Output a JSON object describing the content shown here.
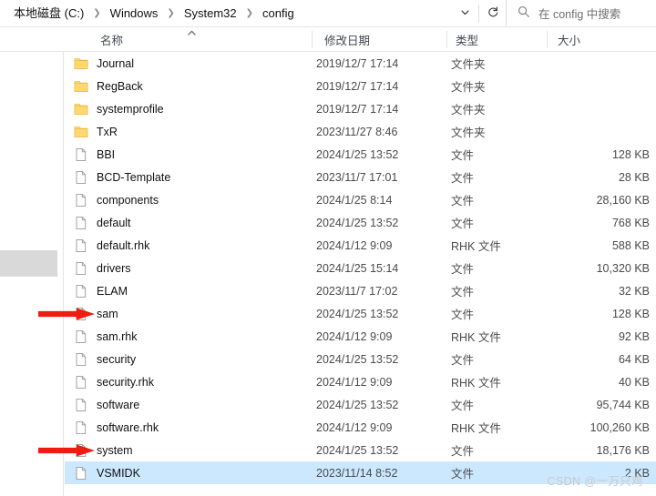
{
  "window": {
    "title": "config"
  },
  "addressbar": {
    "breadcrumbs": [
      {
        "label": "本地磁盘 (C:)"
      },
      {
        "label": "Windows"
      },
      {
        "label": "System32"
      },
      {
        "label": "config"
      }
    ],
    "separator": "❯",
    "dropdown_icon": "chevron-down-icon",
    "refresh_icon": "refresh-icon",
    "search": {
      "icon": "search-icon",
      "placeholder": "在 config 中搜索",
      "value": ""
    }
  },
  "columns": {
    "name": "名称",
    "date_modified": "修改日期",
    "type": "类型",
    "size": "大小",
    "sort": {
      "column": "名称",
      "direction": "ascending",
      "icon": "sort-ascending-caret"
    }
  },
  "files": [
    {
      "name": "Journal",
      "icon": "folder-icon",
      "date": "2019/12/7 17:14",
      "type": "文件夹",
      "size": "",
      "selected": false,
      "arrow": false
    },
    {
      "name": "RegBack",
      "icon": "folder-icon",
      "date": "2019/12/7 17:14",
      "type": "文件夹",
      "size": "",
      "selected": false,
      "arrow": false
    },
    {
      "name": "systemprofile",
      "icon": "folder-icon",
      "date": "2019/12/7 17:14",
      "type": "文件夹",
      "size": "",
      "selected": false,
      "arrow": false
    },
    {
      "name": "TxR",
      "icon": "folder-icon",
      "date": "2023/11/27 8:46",
      "type": "文件夹",
      "size": "",
      "selected": false,
      "arrow": false
    },
    {
      "name": "BBI",
      "icon": "file-icon",
      "date": "2024/1/25 13:52",
      "type": "文件",
      "size": "128 KB",
      "selected": false,
      "arrow": false
    },
    {
      "name": "BCD-Template",
      "icon": "file-icon",
      "date": "2023/11/7 17:01",
      "type": "文件",
      "size": "28 KB",
      "selected": false,
      "arrow": false
    },
    {
      "name": "components",
      "icon": "file-icon",
      "date": "2024/1/25 8:14",
      "type": "文件",
      "size": "28,160 KB",
      "selected": false,
      "arrow": false
    },
    {
      "name": "default",
      "icon": "file-icon",
      "date": "2024/1/25 13:52",
      "type": "文件",
      "size": "768 KB",
      "selected": false,
      "arrow": false
    },
    {
      "name": "default.rhk",
      "icon": "file-icon",
      "date": "2024/1/12 9:09",
      "type": "RHK 文件",
      "size": "588 KB",
      "selected": false,
      "arrow": false
    },
    {
      "name": "drivers",
      "icon": "file-icon",
      "date": "2024/1/25 15:14",
      "type": "文件",
      "size": "10,320 KB",
      "selected": false,
      "arrow": false
    },
    {
      "name": "ELAM",
      "icon": "file-icon",
      "date": "2023/11/7 17:02",
      "type": "文件",
      "size": "32 KB",
      "selected": false,
      "arrow": false
    },
    {
      "name": "sam",
      "icon": "file-icon",
      "date": "2024/1/25 13:52",
      "type": "文件",
      "size": "128 KB",
      "selected": false,
      "arrow": true
    },
    {
      "name": "sam.rhk",
      "icon": "file-icon",
      "date": "2024/1/12 9:09",
      "type": "RHK 文件",
      "size": "92 KB",
      "selected": false,
      "arrow": false
    },
    {
      "name": "security",
      "icon": "file-icon",
      "date": "2024/1/25 13:52",
      "type": "文件",
      "size": "64 KB",
      "selected": false,
      "arrow": false
    },
    {
      "name": "security.rhk",
      "icon": "file-icon",
      "date": "2024/1/12 9:09",
      "type": "RHK 文件",
      "size": "40 KB",
      "selected": false,
      "arrow": false
    },
    {
      "name": "software",
      "icon": "file-icon",
      "date": "2024/1/25 13:52",
      "type": "文件",
      "size": "95,744 KB",
      "selected": false,
      "arrow": false
    },
    {
      "name": "software.rhk",
      "icon": "file-icon",
      "date": "2024/1/12 9:09",
      "type": "RHK 文件",
      "size": "100,260 KB",
      "selected": false,
      "arrow": false
    },
    {
      "name": "system",
      "icon": "file-icon",
      "date": "2024/1/25 13:52",
      "type": "文件",
      "size": "18,176 KB",
      "selected": false,
      "arrow": true
    },
    {
      "name": "VSMIDK",
      "icon": "file-icon",
      "date": "2023/11/14 8:52",
      "type": "文件",
      "size": "2 KB",
      "selected": true,
      "arrow": false
    }
  ],
  "annotation": {
    "arrow_color": "#ee1c11"
  },
  "watermark": {
    "text": "CSDN @一万只鸡"
  },
  "colors": {
    "selection": "#cce8ff",
    "folder": "#ffd970",
    "divider": "#e5e5e5",
    "header_text": "#43484d"
  }
}
